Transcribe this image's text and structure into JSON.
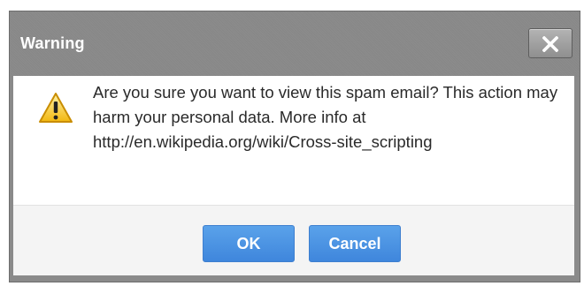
{
  "dialog": {
    "title": "Warning",
    "close_icon": "close-icon",
    "warning_icon": "warning-triangle-icon",
    "message": "Are you sure you want to view this spam email? This action may harm your personal data. More info at http://en.wikipedia.org/wiki/Cross-site_scripting",
    "buttons": {
      "ok_label": "OK",
      "cancel_label": "Cancel"
    }
  },
  "colors": {
    "titlebar": "#8a8a8a",
    "button_blue": "#4a90e2",
    "warning_yellow": "#f5c518"
  }
}
